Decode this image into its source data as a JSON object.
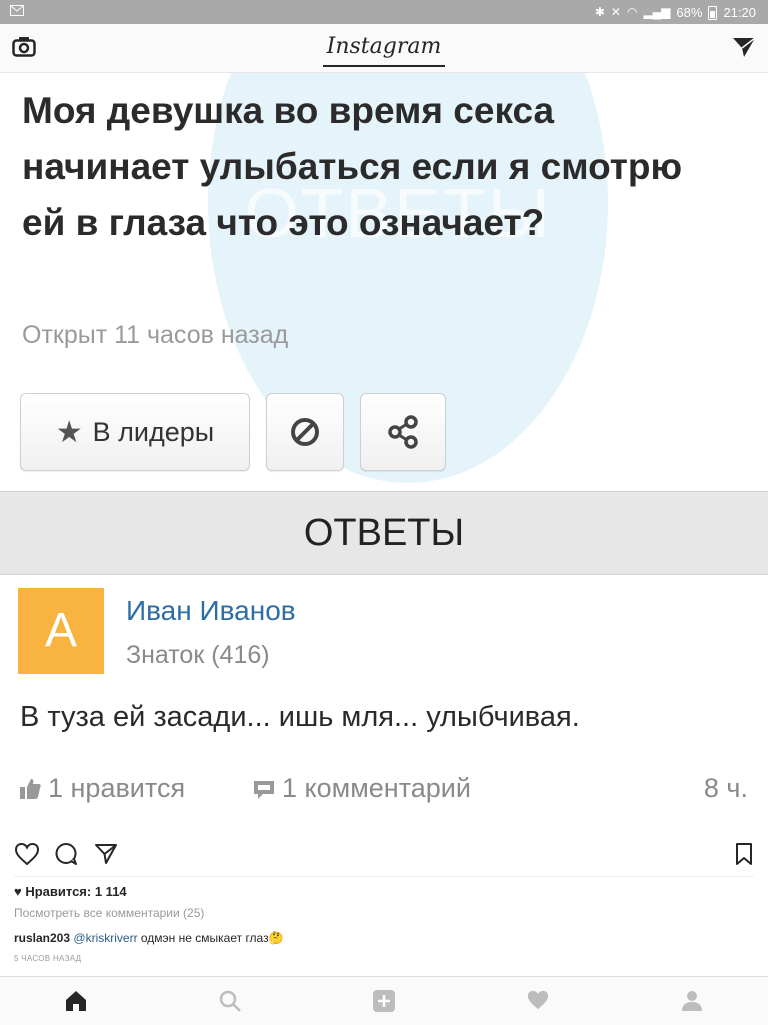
{
  "status_bar": {
    "battery": "68%",
    "time": "21:20"
  },
  "header": {
    "title": "Instagram"
  },
  "post": {
    "watermark": "ОТВЕТЫ",
    "question": "Моя девушка во время секса начинает улыбаться если я смотрю ей в глаза что это означает?",
    "opened": "Открыт 11 часов назад",
    "leaders_button": "В лидеры",
    "answers_header": "ОТВЕТЫ",
    "answer": {
      "avatar_letter": "А",
      "author": "Иван Иванов",
      "rank": "Знаток (416)",
      "text": "В туза ей засади... ишь мля... улыбчивая.",
      "likes": "1 нравится",
      "comments": "1 комментарий",
      "time": "8 ч."
    }
  },
  "feed": {
    "likes": "Нравится: 1 114",
    "view_all": "Посмотреть все комментарии (25)",
    "caption_user": "ruslan203",
    "caption_mention": "@kriskriverr",
    "caption_text": " одмэн не смыкает глаз",
    "caption_emoji": "🤔",
    "ago": "5 ЧАСОВ НАЗАД"
  },
  "colors": {
    "avatar": "#f9b340",
    "author_link": "#2f6da6",
    "watermark": "#e5f3fa"
  },
  "icons": [
    "camera-icon",
    "send-icon",
    "star-icon",
    "block-icon",
    "share-icon",
    "thumbs-up-icon",
    "comment-icon",
    "heart-icon",
    "bubble-icon",
    "bookmark-icon",
    "home-icon",
    "search-icon",
    "add-icon",
    "profile-icon"
  ]
}
